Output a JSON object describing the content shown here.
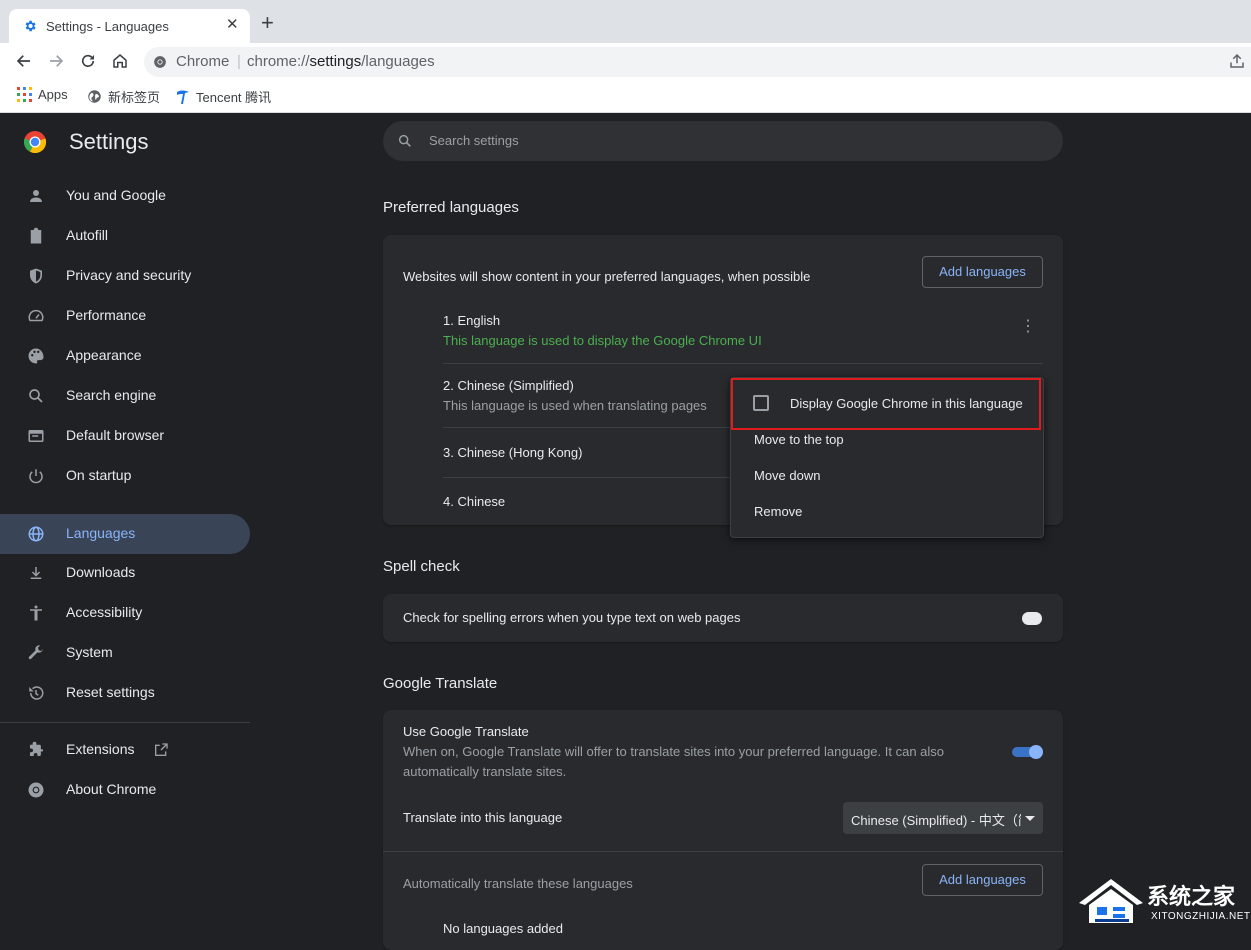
{
  "browser": {
    "tab_title": "Settings - Languages",
    "tab_close": "✕",
    "new_tab": "+",
    "omnibox_site": "Chrome",
    "omnibox_sep": "|",
    "url_prefix": "chrome://",
    "url_host": "settings",
    "url_path": "/languages",
    "bookmarks": [
      {
        "label": "Apps",
        "icon": "apps-grid-icon"
      },
      {
        "label": "新标签页",
        "icon": "globe-icon"
      },
      {
        "label": "Tencent 腾讯",
        "icon": "tencent-icon"
      }
    ]
  },
  "sidebar": {
    "title": "Settings",
    "items": [
      {
        "label": "You and Google",
        "icon": "person-icon"
      },
      {
        "label": "Autofill",
        "icon": "clipboard-icon"
      },
      {
        "label": "Privacy and security",
        "icon": "shield-icon"
      },
      {
        "label": "Performance",
        "icon": "speedometer-icon"
      },
      {
        "label": "Appearance",
        "icon": "palette-icon"
      },
      {
        "label": "Search engine",
        "icon": "search-icon"
      },
      {
        "label": "Default browser",
        "icon": "browser-window-icon"
      },
      {
        "label": "On startup",
        "icon": "power-icon"
      },
      {
        "label": "Languages",
        "icon": "globe-icon",
        "active": true
      },
      {
        "label": "Downloads",
        "icon": "download-icon"
      },
      {
        "label": "Accessibility",
        "icon": "accessibility-icon"
      },
      {
        "label": "System",
        "icon": "wrench-icon"
      },
      {
        "label": "Reset settings",
        "icon": "history-icon"
      },
      {
        "label": "Extensions",
        "icon": "puzzle-icon"
      },
      {
        "label": "About Chrome",
        "icon": "chrome-icon"
      }
    ]
  },
  "search": {
    "placeholder": "Search settings"
  },
  "preferred": {
    "title": "Preferred languages",
    "description": "Websites will show content in your preferred languages, when possible",
    "add_button": "Add languages",
    "languages": [
      {
        "name": "1. English",
        "note": "This language is used to display the Google Chrome UI"
      },
      {
        "name": "2. Chinese (Simplified)",
        "note": "This language is used when translating pages"
      },
      {
        "name": "3. Chinese (Hong Kong)",
        "note": ""
      },
      {
        "name": "4. Chinese",
        "note": ""
      }
    ],
    "more_icon": "⋮"
  },
  "context_menu": {
    "display_label": "Display Google Chrome in this language",
    "display_checked": false,
    "items": [
      "Move to the top",
      "Move down",
      "Remove"
    ]
  },
  "spell": {
    "title": "Spell check",
    "description": "Check for spelling errors when you type text on web pages",
    "enabled": false
  },
  "translate": {
    "title": "Google Translate",
    "use_label": "Use Google Translate",
    "use_desc_1": "When on, Google Translate will offer to translate sites into your preferred language. It can also",
    "use_desc_2": "automatically translate sites.",
    "enabled": true,
    "target_label": "Translate into this language",
    "target_value": "Chinese (Simplified) - 中文（简体）",
    "auto_label": "Automatically translate these languages",
    "add_button": "Add languages",
    "none_added": "No languages added"
  },
  "watermark": {
    "main": "系统之家",
    "site": "XITONGZHIJIA.NET"
  },
  "colors": {
    "accent": "#8ab4f8",
    "green_note": "#4caf50",
    "highlight": "#e01b1b"
  }
}
